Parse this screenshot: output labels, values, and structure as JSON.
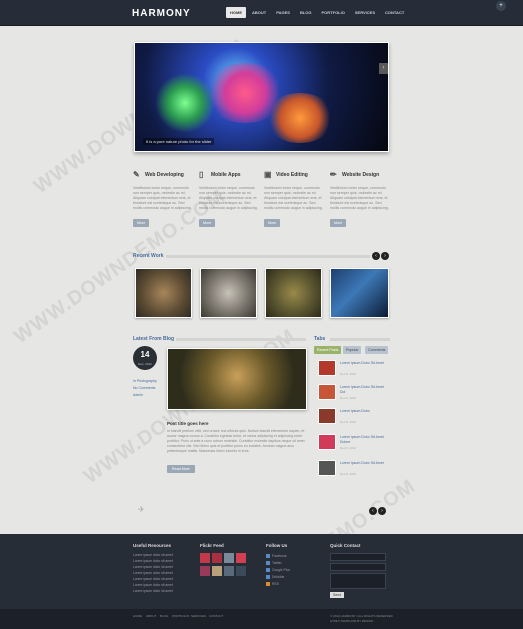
{
  "brand": "HARMONY",
  "nav": [
    "HOME",
    "ABOUT",
    "PAGES",
    "BLOG",
    "PORTFOLIO",
    "SERVICES",
    "CONTACT"
  ],
  "slider": {
    "caption": "It is a pure nature photo for the slider",
    "next": "›"
  },
  "services": [
    {
      "title": "Web Developing",
      "icon": "wrench-icon",
      "glyph": "✎",
      "text": "Vestibulum tortor neque, commodo non semper quis, molestie ac mi. Aliquam volutpat elementum erat, et tincidunt est scelerisque ac. Sed mollis commodo augue in adipiscing.",
      "button": "More"
    },
    {
      "title": "Mobile Apps",
      "icon": "phone-icon",
      "glyph": "▯",
      "text": "Vestibulum tortor neque, commodo non semper quis, molestie ac mi. Aliquam volutpat elementum erat, et tincidunt est scelerisque ac. Sed mollis commodo augue in adipiscing.",
      "button": "More"
    },
    {
      "title": "Video Editing",
      "icon": "film-icon",
      "glyph": "▣",
      "text": "Vestibulum tortor neque, commodo non semper quis, molestie ac mi. Aliquam volutpat elementum erat, et tincidunt est scelerisque ac. Sed mollis commodo augue in adipiscing.",
      "button": "More"
    },
    {
      "title": "Website Design",
      "icon": "pencil-icon",
      "glyph": "✏",
      "text": "Vestibulum tortor neque, commodo non semper quis, molestie ac mi. Aliquam volutpat elementum erat, et tincidunt est scelerisque ac. Sed mollis commodo augue in adipiscing.",
      "button": "More"
    }
  ],
  "recent_work": {
    "heading": "Recent Work",
    "prev": "‹",
    "next": "›"
  },
  "blog": {
    "heading": "Latest From Blog",
    "day": "14",
    "month": "Dec, 2012",
    "meta": [
      "In Photography",
      "No Comments",
      "Admin"
    ],
    "post_title": "Post title goes here",
    "post_text": "In blandit pretium velit, sed ornare orci ultrices quis. Nullam blandit elementum sapien, et auctor magna cursus a. Curabitur egestas tortor, et varius adipiscing et adipiscing tortor porttitor. Proin ut ante a nunc rutrum molestie. Curabitur molestie dapibus neque sit amet consectetur nisi. Sed libero quis et porttitor purus eu sodales. Aenean magna arcu pellentesque mattis. Maecenas libero lobortis in eros.",
    "button": "Read More"
  },
  "tabs": {
    "heading": "Tabs",
    "labels": [
      "Recent Posts",
      "Popular",
      "Comments"
    ],
    "items": [
      {
        "title": "Lorem Ipsum Dolor Sit Amet",
        "date": "Dec 9, 2012"
      },
      {
        "title": "Lorem Ipsum Dolor Sit Amet Dol",
        "date": "Dec 9, 2012"
      },
      {
        "title": "Lorem Ipsum Dolor",
        "date": "Dec 9, 2012"
      },
      {
        "title": "Lorem Ipsum Dolor Sit Amet Dolore",
        "date": "Dec 9, 2012"
      },
      {
        "title": "Lorem Ipsum Dolor Sit Amet",
        "date": "Dec 9, 2012"
      }
    ]
  },
  "pager": {
    "prev": "‹",
    "next": "›"
  },
  "footer": {
    "useful": {
      "heading": "Useful Resources",
      "links": [
        "Lorem ipsum dolor sit amet",
        "Lorem ipsum dolor sit amet",
        "Lorem ipsum dolor sit amet",
        "Lorem ipsum dolor sit amet",
        "Lorem ipsum dolor sit amet",
        "Lorem ipsum dolor sit amet",
        "Lorem ipsum dolor sit amet"
      ]
    },
    "flickr": {
      "heading": "Flickr Feed"
    },
    "social": {
      "heading": "Follow Us",
      "links": [
        "Facebook",
        "Twitter",
        "Google Plus",
        "Dribbble",
        "RSS"
      ]
    },
    "contact": {
      "heading": "Quick Contact",
      "send": "Send"
    }
  },
  "bottom": {
    "links": [
      "HOME",
      "ABOUT",
      "BLOG",
      "PORTFOLIO",
      "SERVICES",
      "CONTACT"
    ],
    "copyright": "© 2012 HARMONY | ALL RIGHTS RESERVED",
    "credit": "HTML5 TEMPLATE BY DESIGN"
  },
  "watermark": "WWW.DOWNDEMO.COM"
}
